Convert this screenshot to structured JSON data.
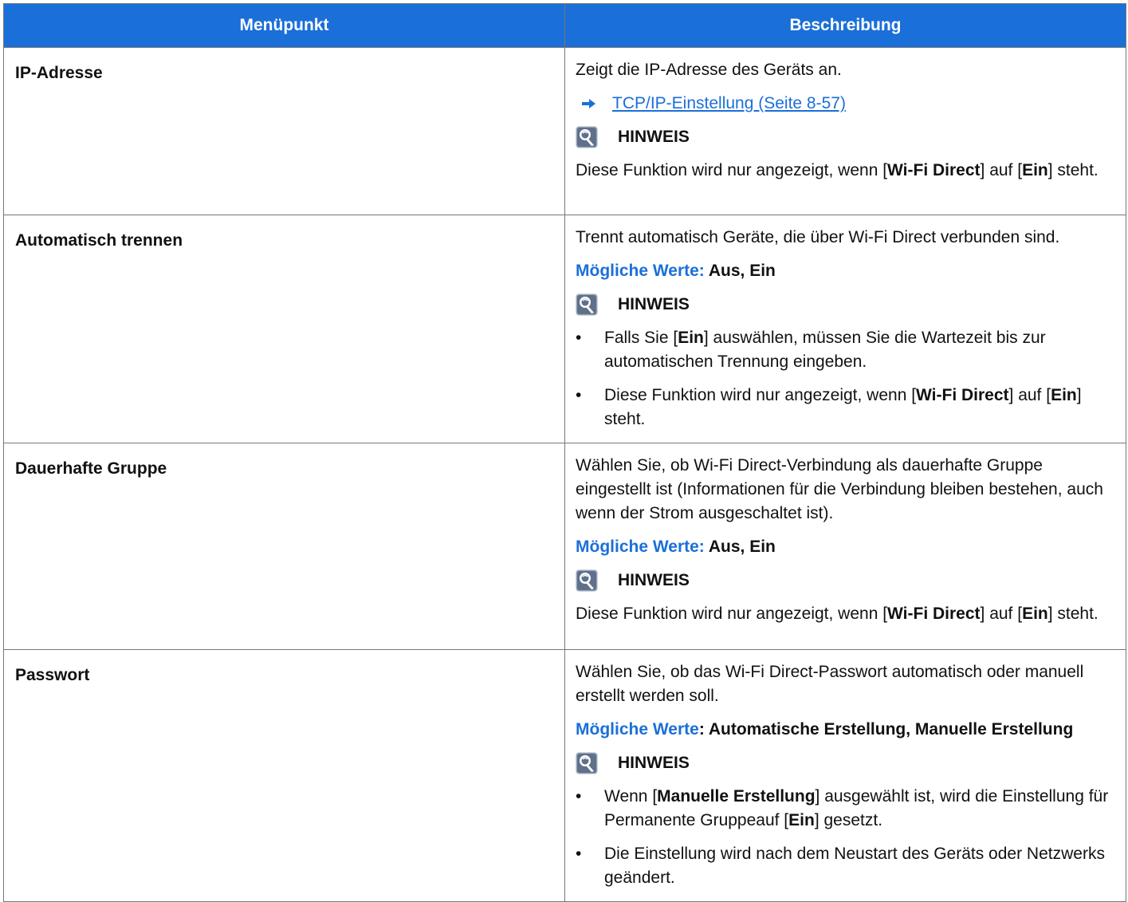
{
  "header": {
    "col1": "Menüpunkt",
    "col2": "Beschreibung"
  },
  "note_label": "HINWEIS",
  "rows": [
    {
      "name": "IP-Adresse",
      "desc": "Zeigt die IP-Adresse des Geräts an.",
      "link": "TCP/IP-Einstellung (Seite 8-57)",
      "note": {
        "pre": "Diese Funktion wird nur angezeigt, wenn [",
        "b1": "Wi-Fi Direct",
        "mid": "] auf [",
        "b2": "Ein",
        "post": "] steht."
      }
    },
    {
      "name": "Automatisch trennen",
      "desc": "Trennt automatisch Geräte, die über Wi-Fi Direct verbunden sind.",
      "values_label": "Mögliche Werte:",
      "values": " Aus, Ein",
      "bullets": [
        {
          "pre": "Falls Sie [",
          "b1": "Ein",
          "post": "] auswählen, müssen Sie die Wartezeit bis zur automatischen Trennung eingeben."
        },
        {
          "pre": "Diese Funktion wird nur angezeigt, wenn [",
          "b1": "Wi-Fi Direct",
          "mid": "] auf [",
          "b2": "Ein",
          "post": "] steht."
        }
      ]
    },
    {
      "name": "Dauerhafte Gruppe",
      "desc": "Wählen Sie, ob Wi-Fi Direct-Verbindung als dauerhafte Gruppe eingestellt ist (Informationen für die Verbindung bleiben bestehen, auch wenn der Strom ausgeschaltet ist).",
      "values_label": "Mögliche Werte:",
      "values": " Aus, Ein",
      "note": {
        "pre": "Diese Funktion wird nur angezeigt, wenn [",
        "b1": "Wi-Fi Direct",
        "mid": "] auf [",
        "b2": "Ein",
        "post": "] steht."
      }
    },
    {
      "name": "Passwort",
      "desc": "Wählen Sie, ob das Wi-Fi Direct-Passwort automatisch oder manuell erstellt werden soll.",
      "values_label": "Mögliche Werte",
      "values": ": Automatische Erstellung, Manuelle Erstellung",
      "bullets": [
        {
          "pre": "Wenn [",
          "b1": "Manuelle Erstellung",
          "mid": "] ausgewählt ist, wird die Einstellung für Permanente Gruppeauf [",
          "b2": "Ein",
          "post": "] gesetzt."
        },
        {
          "pre": "Die Einstellung wird nach dem Neustart des Geräts oder Netzwerks geändert."
        }
      ]
    }
  ]
}
